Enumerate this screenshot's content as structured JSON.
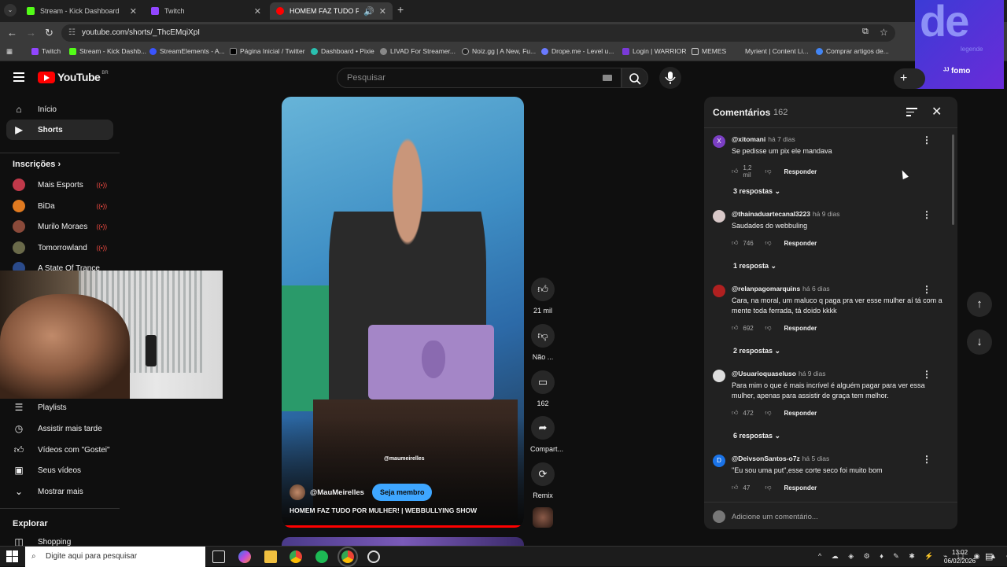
{
  "browser": {
    "tabs": [
      {
        "title": "Stream - Kick Dashboard",
        "color": "#53fc18"
      },
      {
        "title": "Twitch",
        "color": "#9146ff"
      },
      {
        "title": "HOMEM FAZ TUDO POR M",
        "color": "#ff0000"
      }
    ],
    "url": "youtube.com/shorts/_ThcEMqiXpI",
    "bookmarks": [
      "Twitch",
      "Stream - Kick Dashb...",
      "StreamElements - A...",
      "Página Inicial / Twitter",
      "Dashboard • Pixie",
      "LIVAD For Streamer...",
      "Noiz.gg | A New, Fu...",
      "Drope.me - Level u...",
      "Login | WARRIOR",
      "MEMES",
      "Myrient | Content Li...",
      "Comprar artigos de..."
    ]
  },
  "overlay": {
    "brand": "de",
    "sub": "legende",
    "fomo": "fomo"
  },
  "header": {
    "logo_text": "YouTube",
    "country": "BR",
    "search_placeholder": "Pesquisar"
  },
  "sidebar": {
    "home": "Início",
    "shorts": "Shorts",
    "subscriptions_title": "Inscrições",
    "subscriptions": [
      {
        "name": "Mais Esports",
        "color": "#c0394a"
      },
      {
        "name": "BiDa",
        "color": "#e07a20"
      },
      {
        "name": "Murilo Moraes",
        "color": "#8a4a3a"
      },
      {
        "name": "Tomorrowland",
        "color": "#6a6a4a"
      },
      {
        "name": "A State Of Trance",
        "color": "#2a4a8a"
      }
    ],
    "playlists": "Playlists",
    "watch_later": "Assistir mais tarde",
    "liked": "Vídeos com \"Gostei\"",
    "your_videos": "Seus vídeos",
    "show_more": "Mostrar mais",
    "explore_title": "Explorar",
    "shopping": "Shopping"
  },
  "short": {
    "channel": "@MauMeirelles",
    "watermark": "@maumeirelles",
    "join_label": "Seja membro",
    "title": "HOMEM FAZ TUDO POR MULHER! | WEBBULLYING SHOW",
    "progress": 1.0
  },
  "actions": {
    "likes": "21 mil",
    "dislike": "Não ...",
    "comments": "162",
    "share": "Compart...",
    "remix": "Remix"
  },
  "comments_panel": {
    "title": "Comentários",
    "count": "162",
    "add_placeholder": "Adicione um comentário...",
    "reply_label": "Responder",
    "items": [
      {
        "user": "@xitomani",
        "time": "há 7 dias",
        "text": "Se pedisse um pix ele mandava",
        "likes": "1,2 mil",
        "replies": "3 respostas",
        "avatar": "X",
        "avatar_color": "#7b3fc4"
      },
      {
        "user": "@thainaduartecanal3223",
        "time": "há 9 dias",
        "text": "Saudades do webbuling",
        "likes": "746",
        "replies": "1 resposta",
        "avatar": "",
        "avatar_color": "#d8c8c8"
      },
      {
        "user": "@relanpagomarquins",
        "time": "há 6 dias",
        "text": "Cara, na moral, um maluco q paga pra ver esse mulher aí tá com a mente toda ferrada, tá doido kkkk",
        "likes": "692",
        "replies": "2 respostas",
        "avatar": "",
        "avatar_color": "#b02020"
      },
      {
        "user": "@Usuarioquaseluso",
        "time": "há 9 dias",
        "text": "Para mim o que é mais incrível é alguém pagar para ver essa mulher, apenas para assistir de graça tem melhor.",
        "likes": "472",
        "replies": "6 respostas",
        "avatar": "",
        "avatar_color": "#dddddd"
      },
      {
        "user": "@DeivsonSantos-o7z",
        "time": "há 5 dias",
        "text": "\"Eu sou uma put\",esse corte seco foi muito bom",
        "likes": "47",
        "replies": "",
        "avatar": "D",
        "avatar_color": "#1a73e8"
      }
    ]
  },
  "taskbar": {
    "search_placeholder": "Digite aqui para pesquisar",
    "time": "13:02",
    "date": "06/02/2026"
  }
}
